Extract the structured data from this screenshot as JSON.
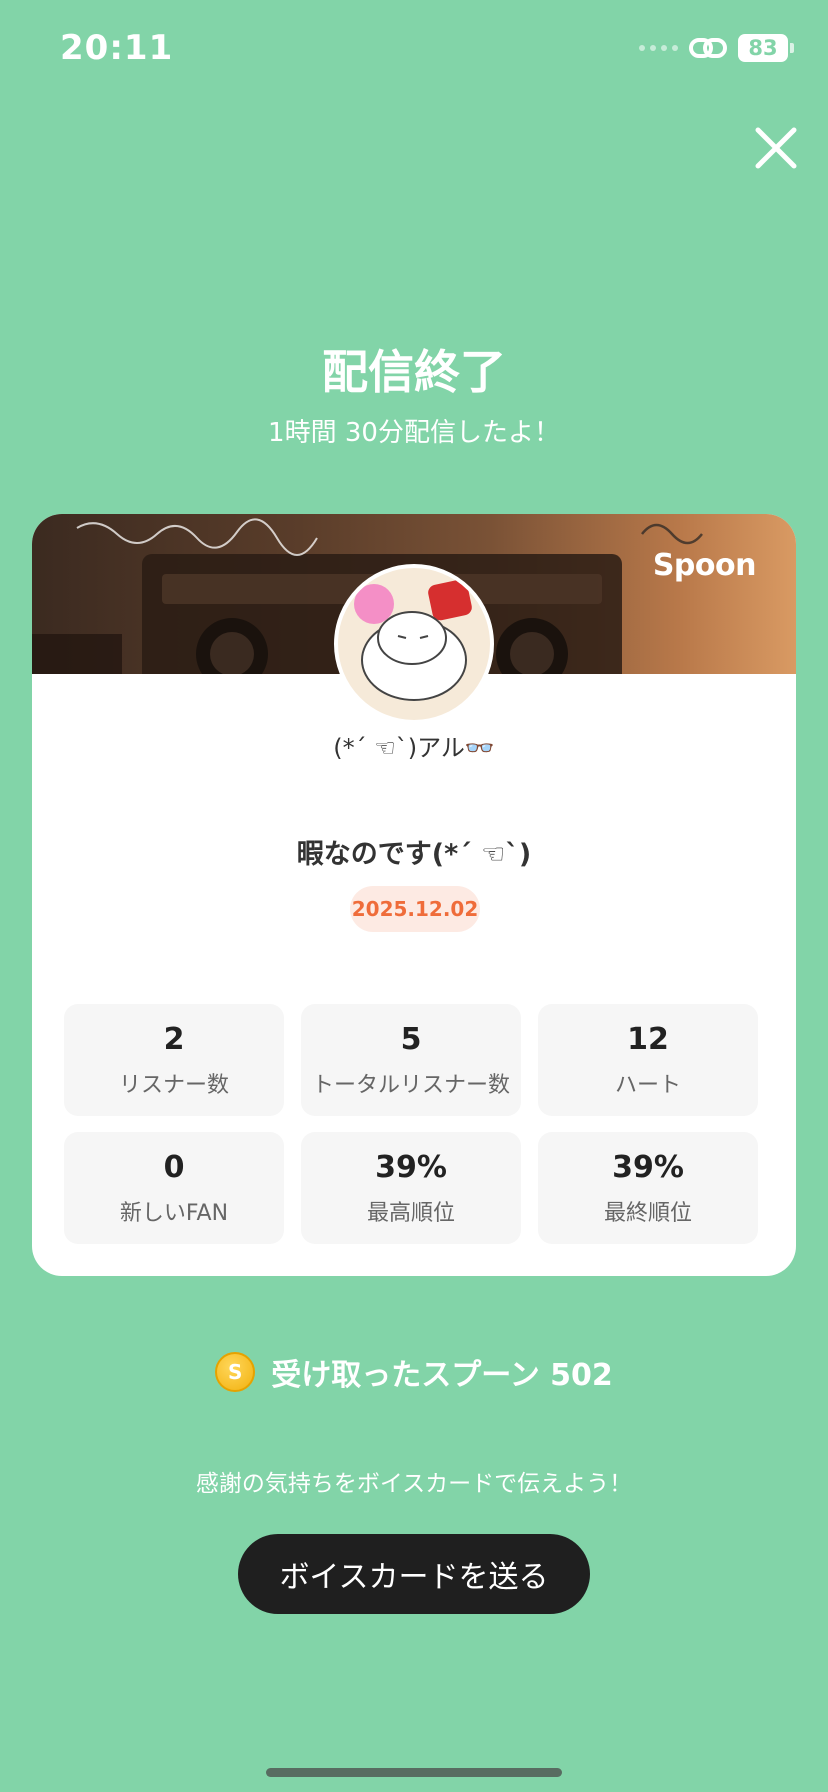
{
  "status_bar": {
    "time": "20:11",
    "battery": "83"
  },
  "header": {
    "title": "配信終了",
    "subtitle": "1時間 30分配信したよ！"
  },
  "card": {
    "banner_logo": "Spoon",
    "dj_name": "(*´ ☜`)アル👓",
    "broadcast_title": "暇なのです(*´ ☜`)",
    "date": "2025.12.02",
    "stats": [
      {
        "value": "2",
        "label": "リスナー数"
      },
      {
        "value": "5",
        "label": "トータルリスナー数"
      },
      {
        "value": "12",
        "label": "ハート"
      },
      {
        "value": "0",
        "label": "新しいFAN"
      },
      {
        "value": "39%",
        "label": "最高順位"
      },
      {
        "value": "39%",
        "label": "最終順位"
      }
    ]
  },
  "spoons": {
    "label": "受け取ったスプーン  502"
  },
  "voice_card": {
    "prompt": "感謝の気持ちをボイスカードで伝えよう！",
    "button_label": "ボイスカードを送る"
  },
  "colors": {
    "background": "#82d4a8",
    "button": "#1f1f1f",
    "date_badge_text": "#ef6c3a",
    "date_badge_bg": "#fdeae3"
  },
  "icons": [
    "close-icon",
    "link-icon",
    "battery-icon",
    "coin-icon"
  ]
}
